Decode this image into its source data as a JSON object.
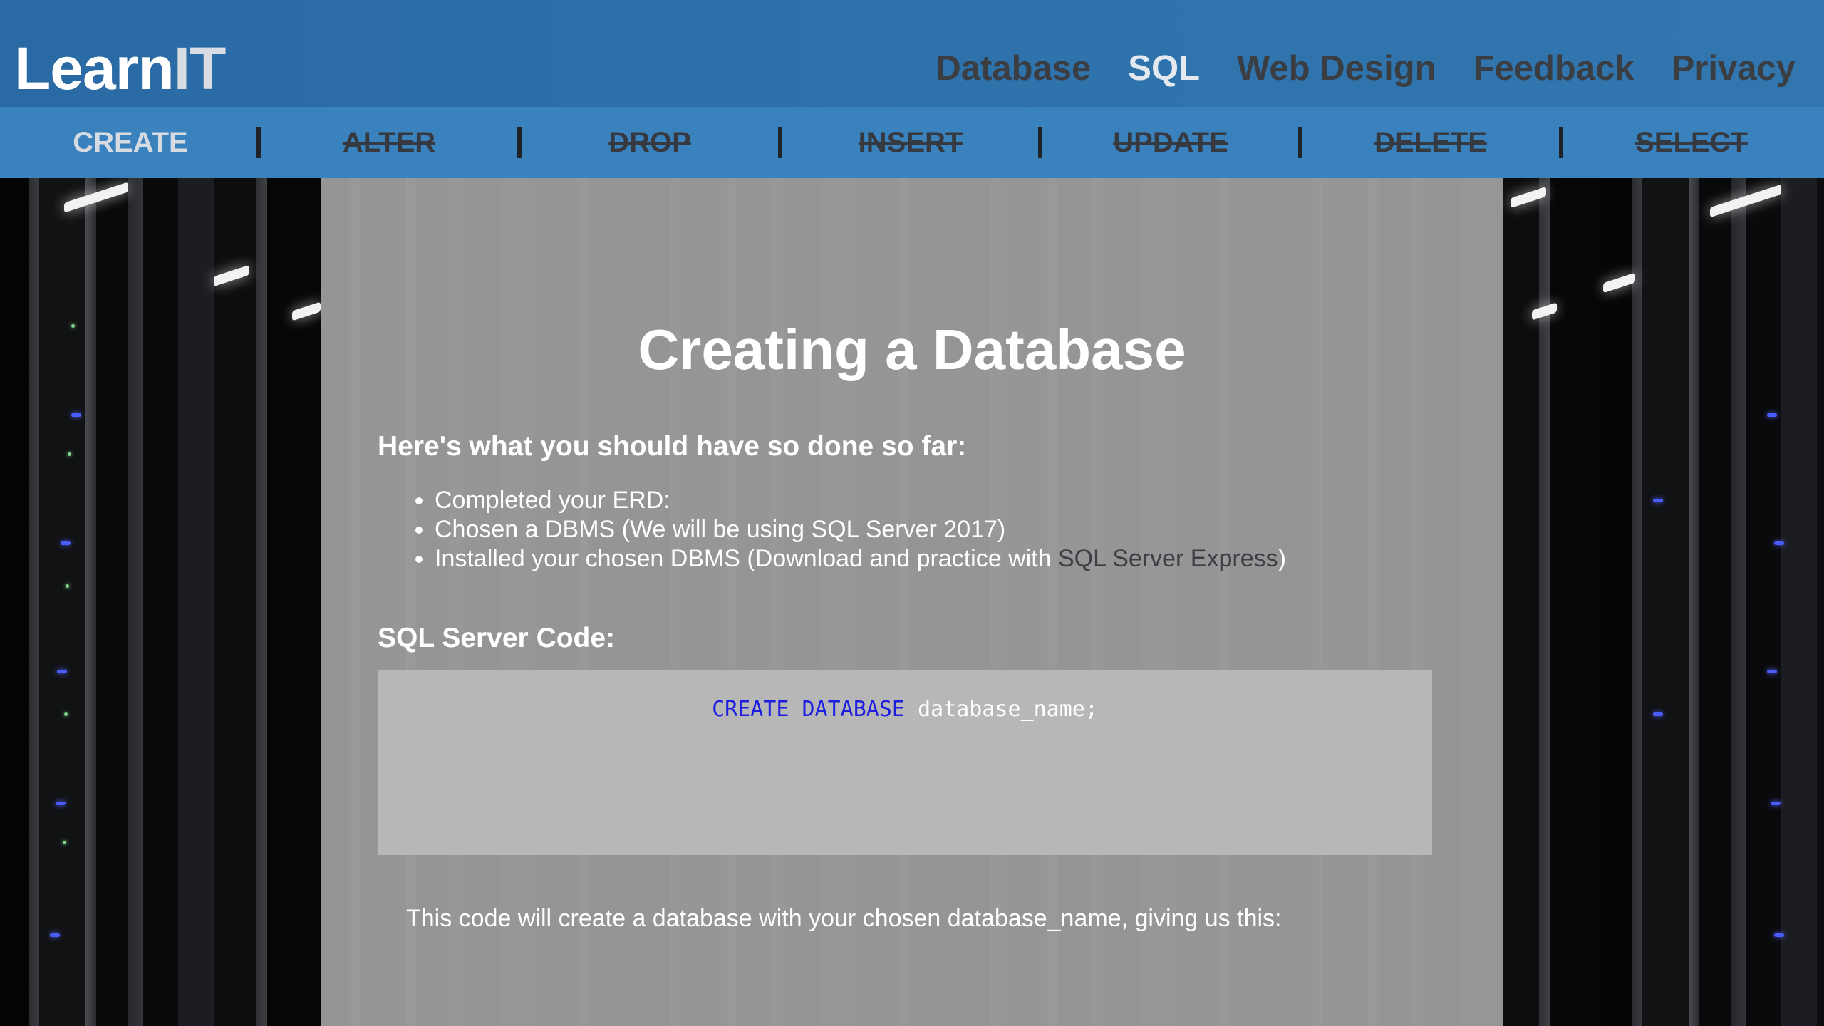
{
  "header": {
    "logo_main": "Learn",
    "logo_accent": "IT",
    "nav": [
      {
        "label": "Database"
      },
      {
        "label": "SQL"
      },
      {
        "label": "Web Design"
      },
      {
        "label": "Feedback"
      },
      {
        "label": "Privacy"
      }
    ],
    "active_nav": "SQL"
  },
  "subnav": {
    "items": [
      "CREATE",
      "ALTER",
      "DROP",
      "INSERT",
      "UPDATE",
      "DELETE",
      "SELECT"
    ],
    "active": "CREATE"
  },
  "main": {
    "title": "Creating a Database",
    "progress_heading": "Here's what you should have so done so far:",
    "bullets": {
      "b1": "Completed your ERD:",
      "b2": "Chosen a DBMS (We will be using SQL Server 2017)",
      "b3_prefix": "Installed your chosen DBMS (Download and practice with ",
      "b3_link": "SQL Server Express",
      "b3_suffix": ")"
    },
    "code_heading": "SQL Server Code:",
    "code": {
      "kw1": "CREATE",
      "kw2": "DATABASE",
      "rest": " database_name;"
    },
    "description": "This code will create a database with your chosen database_name, giving us this:"
  },
  "colors": {
    "header_bg": "#2e6fa8",
    "subnav_bg": "#3a82bd",
    "panel_bg": "#a0a0a0",
    "code_bg": "#b7b7b7",
    "keyword": "#1e1ee0"
  }
}
